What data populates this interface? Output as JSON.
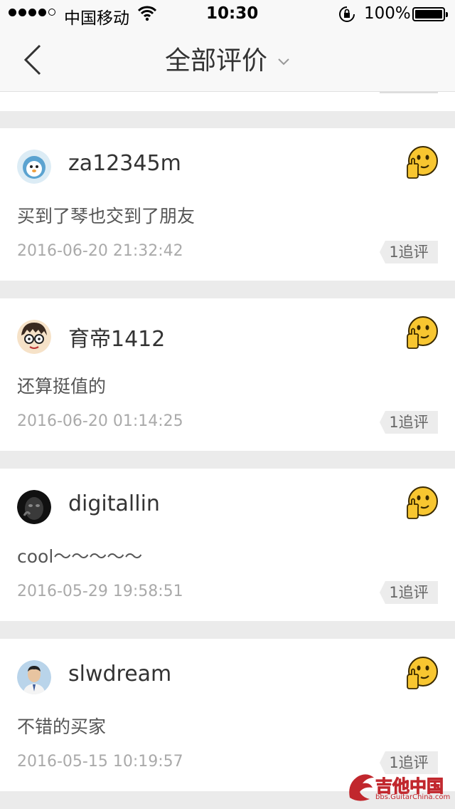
{
  "status_bar": {
    "carrier": "中国移动",
    "time": "10:30",
    "battery": "100%"
  },
  "nav": {
    "title": "全部评价"
  },
  "reviews": [
    {
      "username": "za12345m",
      "comment": "买到了琴也交到了朋友",
      "date": "2016-06-20 21:32:42",
      "follow": "1追评"
    },
    {
      "username": "育帝1412",
      "comment": "还算挺值的",
      "date": "2016-06-20 01:14:25",
      "follow": "1追评"
    },
    {
      "username": "digitallin",
      "comment": "cool～～～～～",
      "date": "2016-05-29 19:58:51",
      "follow": "1追评"
    },
    {
      "username": "slwdream",
      "comment": "不错的买家",
      "date": "2016-05-15 10:19:57",
      "follow": "1追评"
    }
  ],
  "watermark": {
    "name": "吉他中国",
    "url": "bbs.GuitarChina.com"
  },
  "colors": {
    "background": "#ebebeb",
    "card": "#ffffff",
    "face": "#f8c630",
    "watermark": "#c1272d"
  }
}
